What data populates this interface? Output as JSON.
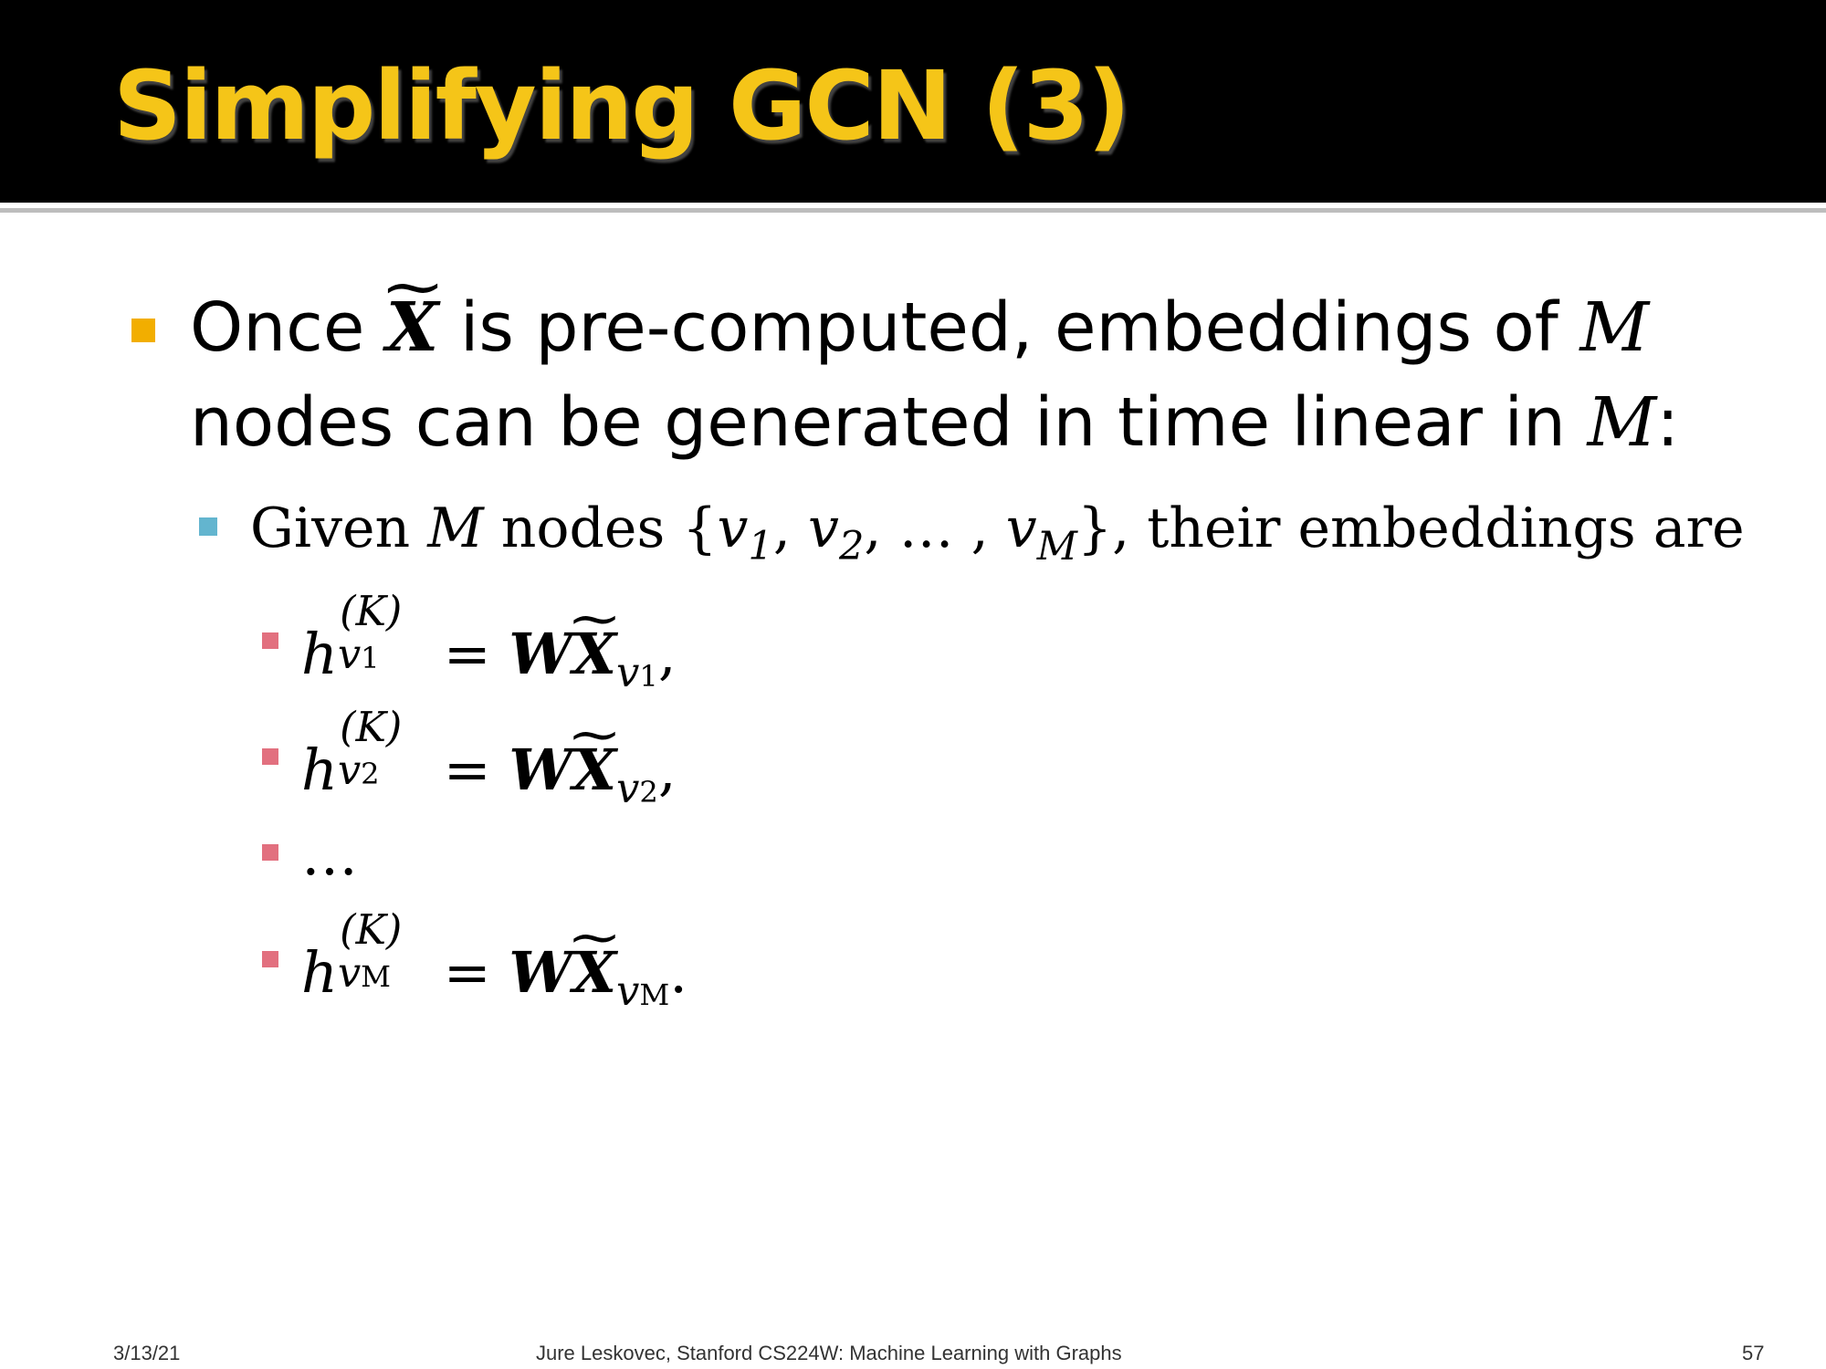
{
  "slide": {
    "title": "Simplifying GCN (3)",
    "bullet1": {
      "once": "Once",
      "X": "X",
      "text1": " is pre-computed, embeddings of ",
      "M": "M",
      "text2": "nodes can be generated in time linear in ",
      "M2": "M",
      "colon": ":"
    },
    "bullet2": {
      "given": "Given ",
      "M": "M",
      "nodes": " nodes {",
      "v": "v",
      "s1": "1",
      "comma1": ", ",
      "s2": "2",
      "dots": ", … , ",
      "sM": "M",
      "rest": "}, their embeddings are"
    },
    "equations": [
      {
        "h": "h",
        "sup": "(K)",
        "sub": "v",
        "subsub": "1",
        "eq": " = ",
        "W": "W",
        "X": "X",
        "rhs_sub": "v",
        "rhs_subsub": "1",
        "end": ","
      },
      {
        "h": "h",
        "sup": "(K)",
        "sub": "v",
        "subsub": "2",
        "eq": " = ",
        "W": "W",
        "X": "X",
        "rhs_sub": "v",
        "rhs_subsub": "2",
        "end": ","
      },
      {
        "ellipsis": "…"
      },
      {
        "h": "h",
        "sup": "(K)",
        "sub": "v",
        "subsub": "M",
        "eq": " = ",
        "W": "W",
        "X": "X",
        "rhs_sub": "v",
        "rhs_subsub": "M",
        "end": "."
      }
    ]
  },
  "footer": {
    "date": "3/13/21",
    "credit": "Jure Leskovec, Stanford CS224W: Machine Learning with Graphs",
    "page": "57"
  },
  "colors": {
    "header_bg": "#000000",
    "title": "#f5c518",
    "bullet_l1": "#f2ae00",
    "bullet_l2": "#63b5cf",
    "bullet_l3": "#e2707f"
  }
}
